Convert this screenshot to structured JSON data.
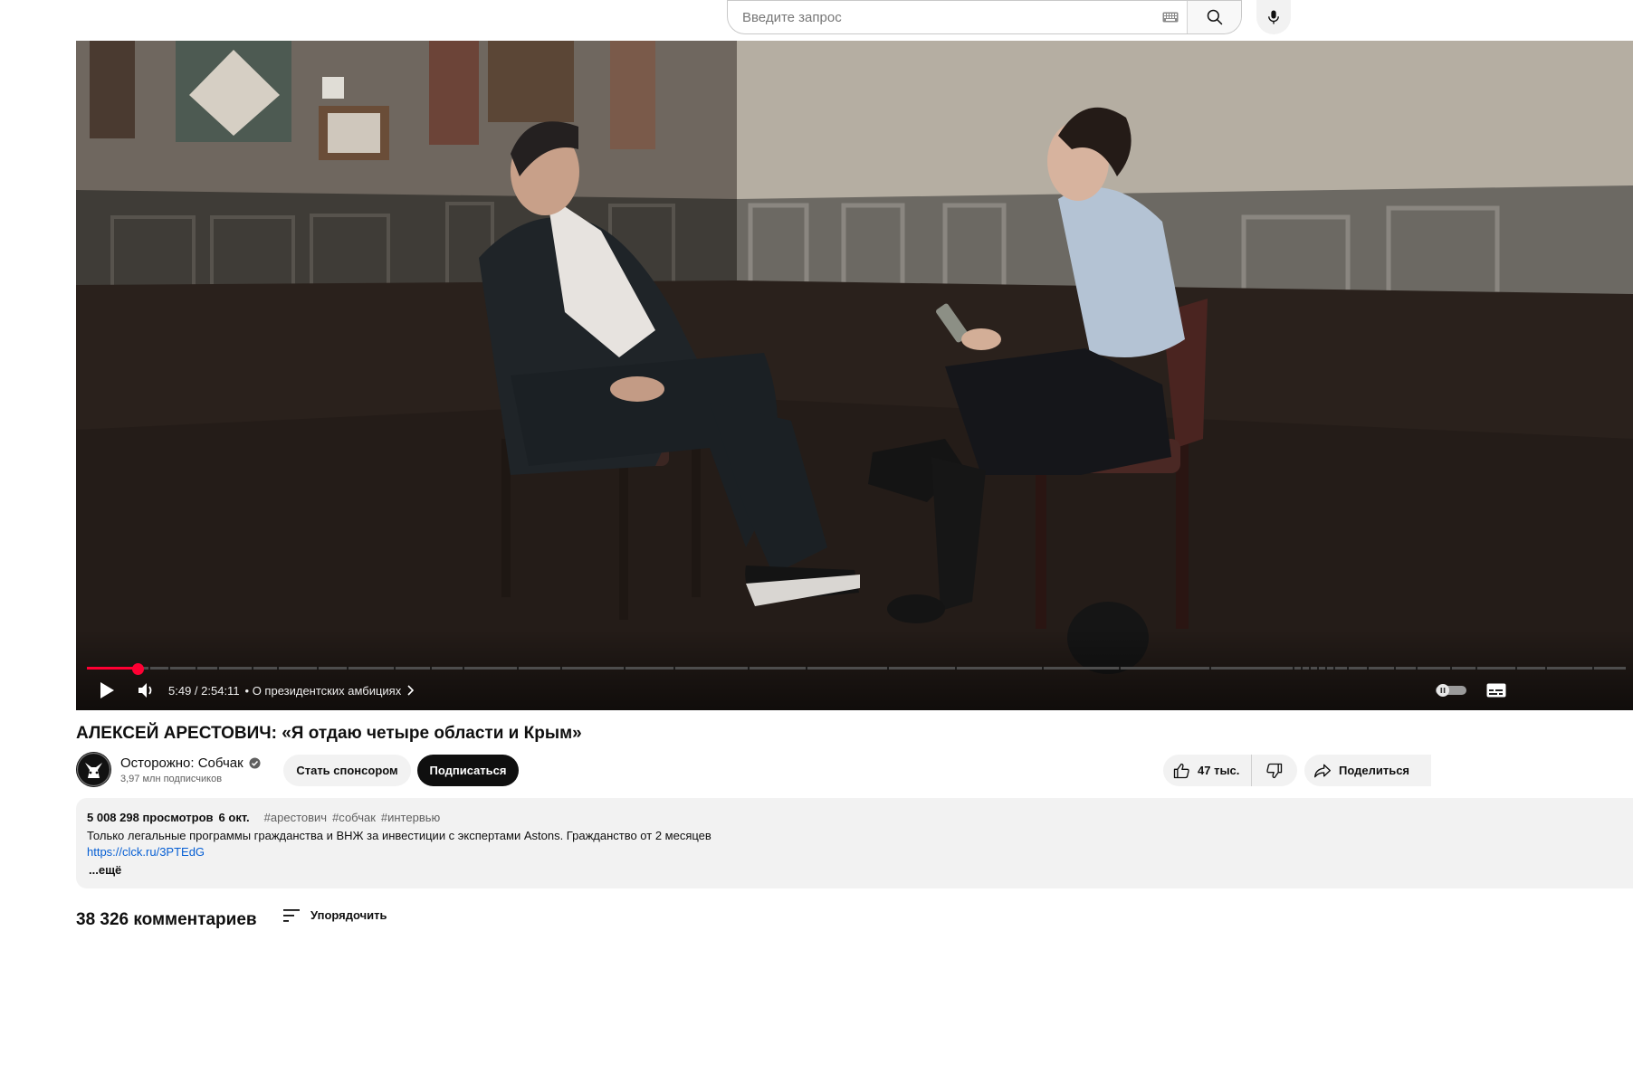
{
  "search": {
    "placeholder": "Введите запрос"
  },
  "player": {
    "time": "5:49 / 2:54:11",
    "chapter": "• О президентских амбициях",
    "progress_fraction": 0.0334,
    "accent_color": "#ff0033"
  },
  "video": {
    "title": "АЛЕКСЕЙ АРЕСТОВИЧ: «Я отдаю четыре области и Крым»"
  },
  "channel": {
    "name": "Осторожно: Собчак",
    "subscribers": "3,97 млн подписчиков",
    "verified": true
  },
  "actions": {
    "sponsor_label": "Стать спонсором",
    "subscribe_label": "Подписаться",
    "likes": "47 тыс.",
    "share_label": "Поделиться"
  },
  "description": {
    "views": "5 008 298 просмотров",
    "date": "6 окт.",
    "tags": [
      "#арестович",
      "#собчак",
      "#интервью"
    ],
    "text": "Только легальные программы гражданства и ВНЖ за инвестиции с экспертами Astons. Гражданство от 2 месяцев",
    "link": "https://clck.ru/3PTEdG",
    "more_label": "...ещё"
  },
  "comments": {
    "count_label": "38 326 комментариев",
    "sort_label": "Упорядочить"
  },
  "icons": {
    "keyboard": "keyboard-icon",
    "search": "search-icon",
    "mic": "mic-icon",
    "play": "play-icon",
    "volume": "volume-icon",
    "chevron": "chevron-right-icon",
    "autoplay": "autoplay-toggle-icon",
    "subtitles": "subtitles-icon",
    "verified": "verified-icon",
    "like": "thumbs-up-icon",
    "dislike": "thumbs-down-icon",
    "share": "share-icon",
    "sort": "sort-icon"
  }
}
